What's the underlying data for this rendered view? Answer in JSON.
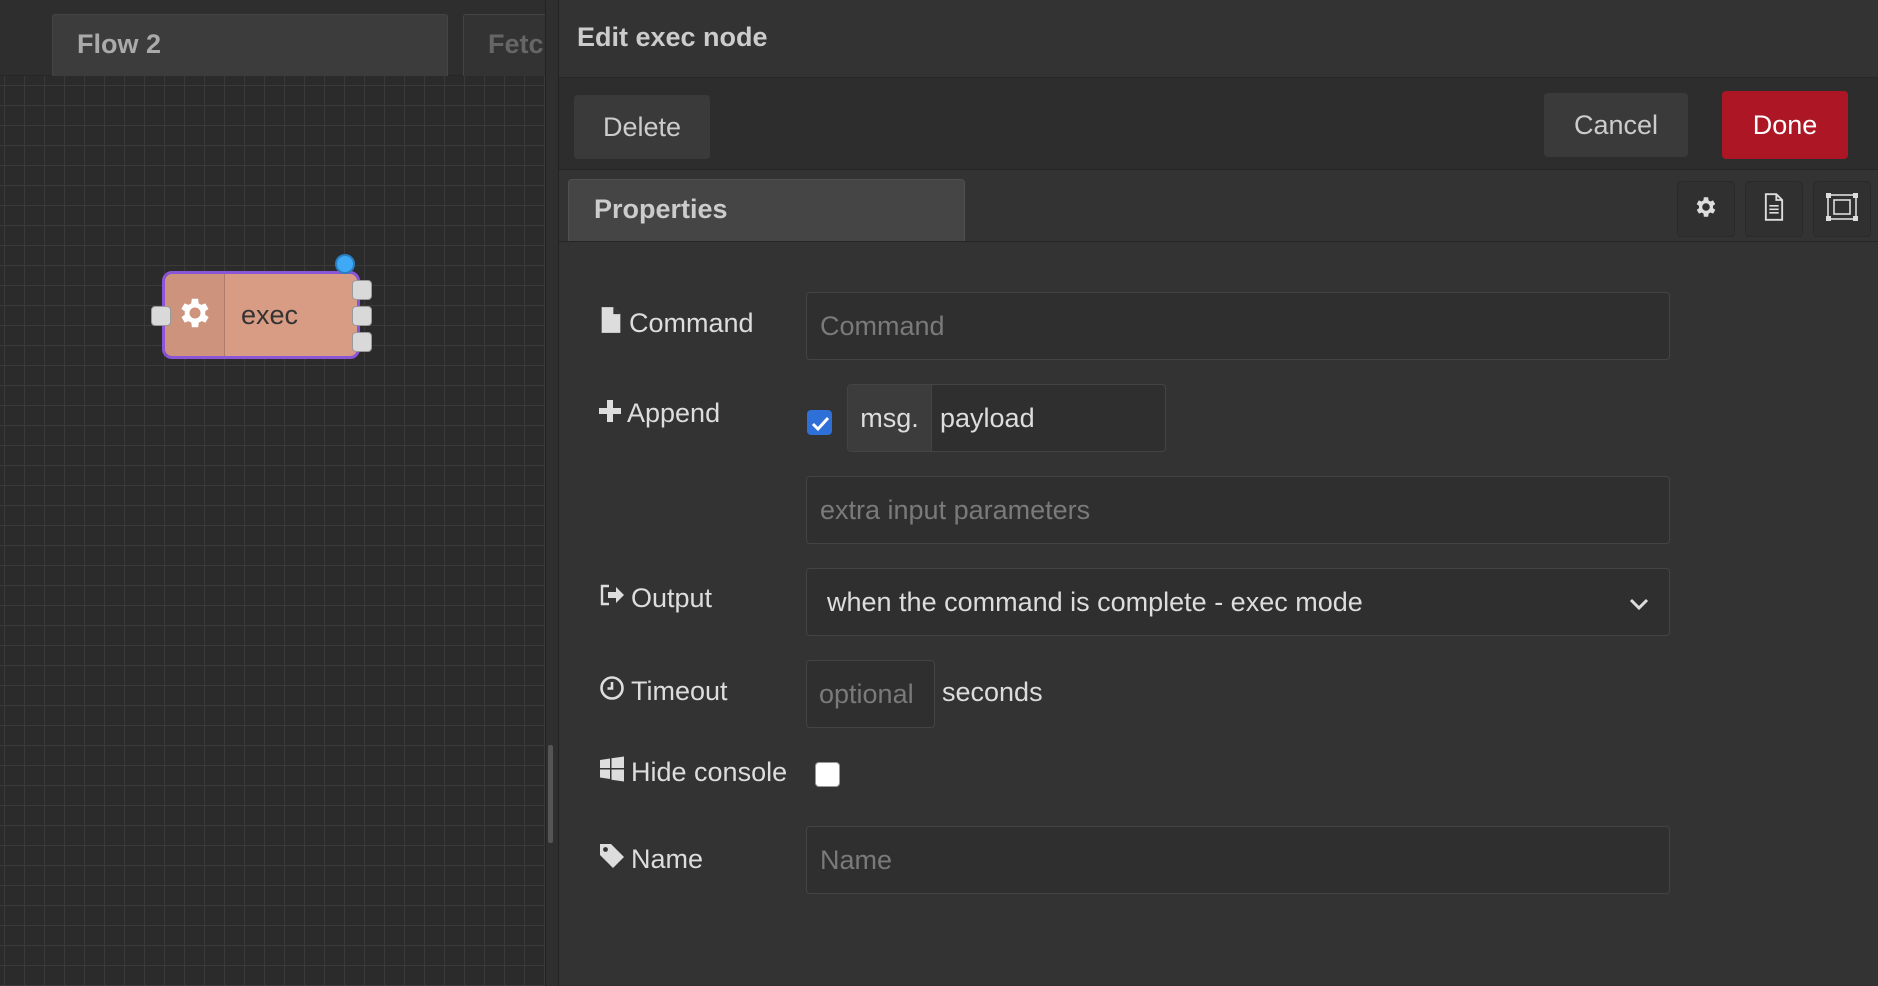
{
  "workspace": {
    "tabs": [
      {
        "label": "Flow 2"
      },
      {
        "label": "Fetc"
      }
    ],
    "node": {
      "label": "exec",
      "icon": "gear-icon",
      "color": "#d89b84",
      "selected_border": "#8a55d6"
    }
  },
  "editor": {
    "title": "Edit exec node",
    "buttons": {
      "delete": "Delete",
      "cancel": "Cancel",
      "done": "Done"
    },
    "tab": "Properties",
    "side_icons": [
      "gear-icon",
      "document-icon",
      "appearance-icon"
    ],
    "form": {
      "command": {
        "label": "Command",
        "placeholder": "Command",
        "value": ""
      },
      "append": {
        "label": "Append",
        "checked": true,
        "prefix": "msg.",
        "value": "payload",
        "extra_placeholder": "extra input parameters"
      },
      "output": {
        "label": "Output",
        "value": "when the command is complete - exec mode"
      },
      "timeout": {
        "label": "Timeout",
        "placeholder": "optional",
        "suffix": "seconds"
      },
      "hide_console": {
        "label": "Hide console",
        "checked": false
      },
      "name": {
        "label": "Name",
        "placeholder": "Name",
        "value": ""
      }
    },
    "colors": {
      "done": "#ad1625",
      "checkbox": "#2e6fd8"
    }
  }
}
